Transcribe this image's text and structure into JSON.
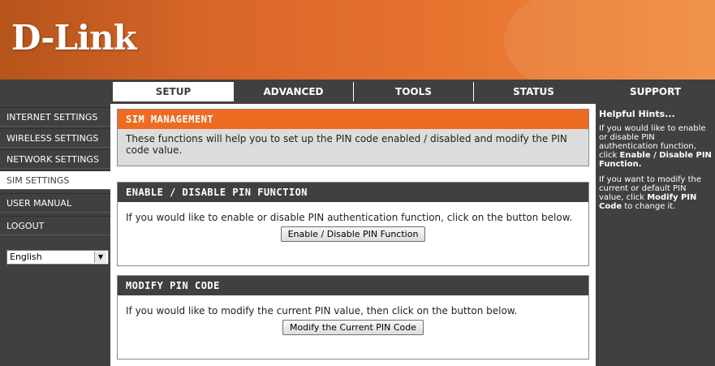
{
  "brand": {
    "logo": "D-Link"
  },
  "nav": {
    "tabs": [
      "SETUP",
      "ADVANCED",
      "TOOLS",
      "STATUS"
    ],
    "support": "SUPPORT",
    "active_tab": "SETUP"
  },
  "sidebar": {
    "items": [
      {
        "label": "INTERNET SETTINGS"
      },
      {
        "label": "WIRELESS SETTINGS"
      },
      {
        "label": "NETWORK SETTINGS"
      },
      {
        "label": "SIM SETTINGS"
      },
      {
        "label": "USER MANUAL"
      },
      {
        "label": "LOGOUT"
      }
    ],
    "active_item": "SIM SETTINGS",
    "language": "English"
  },
  "sim_mgmt": {
    "title": "SIM MANAGEMENT",
    "description": "These functions will help you to set up the PIN code enabled / disabled and modify the PIN code value."
  },
  "enable_pin": {
    "title": "ENABLE / DISABLE PIN FUNCTION",
    "text": "If you would like to enable or disable PIN authentication function, click on the button below.",
    "button": "Enable / Disable PIN Function"
  },
  "modify_pin": {
    "title": "MODIFY PIN CODE",
    "text": "If you would like to modify the current PIN value, then click on the button below.",
    "button": "Modify the Current PIN Code"
  },
  "hints": {
    "title": "Helpful Hints...",
    "hint1_prefix": "If you would like to enable or disable PIN authentication function, click ",
    "hint1_bold": "Enable / Disable PIN Function.",
    "hint2_prefix": "If you want to modify the current or default PIN value, click ",
    "hint2_bold": "Modify PIN Code",
    "hint2_suffix": " to change it."
  },
  "colors": {
    "brand_orange": "#ed6c22",
    "dark_grey": "#404040"
  }
}
